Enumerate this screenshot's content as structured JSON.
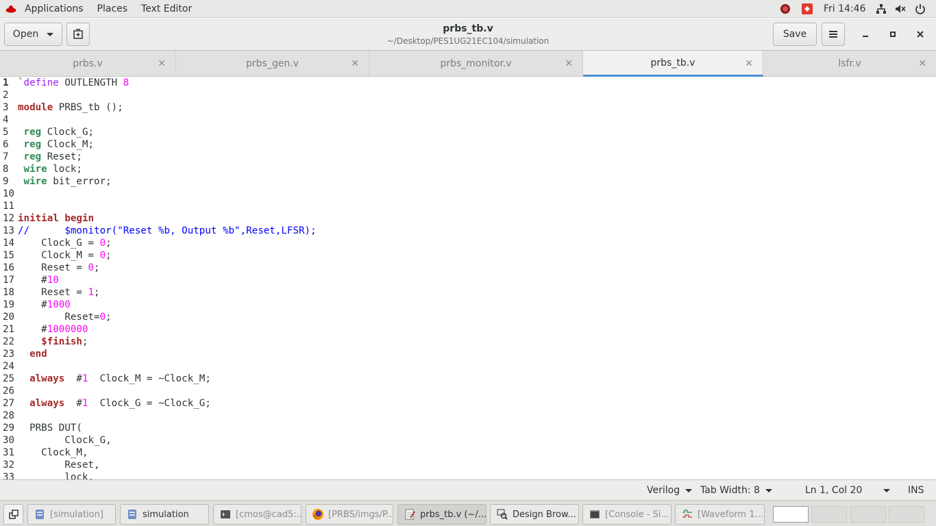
{
  "topbar": {
    "menus": [
      "Applications",
      "Places",
      "Text Editor"
    ],
    "clock": "Fri 14:46"
  },
  "header": {
    "open_label": "Open",
    "title": "prbs_tb.v",
    "subtitle": "~/Desktop/PES1UG21EC104/simulation",
    "save_label": "Save"
  },
  "tabs": [
    {
      "label": "prbs.v"
    },
    {
      "label": "prbs_gen.v"
    },
    {
      "label": "prbs_monitor.v"
    },
    {
      "label": "prbs_tb.v"
    },
    {
      "label": "lsfr.v"
    }
  ],
  "editor": {
    "active_tab": "prbs_tb.v",
    "lines": [
      [
        {
          "t": "`",
          "c": ""
        },
        {
          "t": "define",
          "c": "pp"
        },
        {
          "t": " OUTLENGTH ",
          "c": ""
        },
        {
          "t": "8",
          "c": "num"
        }
      ],
      [],
      [
        {
          "t": "module",
          "c": "kw-b"
        },
        {
          "t": " PRBS_tb ();",
          "c": ""
        }
      ],
      [],
      [
        {
          "t": " ",
          "c": ""
        },
        {
          "t": "reg",
          "c": "kw-g"
        },
        {
          "t": " Clock_G;",
          "c": ""
        }
      ],
      [
        {
          "t": " ",
          "c": ""
        },
        {
          "t": "reg",
          "c": "kw-g"
        },
        {
          "t": " Clock_M;",
          "c": ""
        }
      ],
      [
        {
          "t": " ",
          "c": ""
        },
        {
          "t": "reg",
          "c": "kw-g"
        },
        {
          "t": " Reset;",
          "c": ""
        }
      ],
      [
        {
          "t": " ",
          "c": ""
        },
        {
          "t": "wire",
          "c": "kw-g"
        },
        {
          "t": " lock;",
          "c": ""
        }
      ],
      [
        {
          "t": " ",
          "c": ""
        },
        {
          "t": "wire",
          "c": "kw-g"
        },
        {
          "t": " bit_error;",
          "c": ""
        }
      ],
      [],
      [],
      [
        {
          "t": "initial",
          "c": "kw-b"
        },
        {
          "t": " ",
          "c": ""
        },
        {
          "t": "begin",
          "c": "kw-b"
        }
      ],
      [
        {
          "t": "//      $monitor(\"Reset %b, Output %b\",Reset,LFSR);",
          "c": "cmt"
        }
      ],
      [
        {
          "t": "    Clock_G = ",
          "c": ""
        },
        {
          "t": "0",
          "c": "num"
        },
        {
          "t": ";",
          "c": ""
        }
      ],
      [
        {
          "t": "    Clock_M = ",
          "c": ""
        },
        {
          "t": "0",
          "c": "num"
        },
        {
          "t": ";",
          "c": ""
        }
      ],
      [
        {
          "t": "    Reset = ",
          "c": ""
        },
        {
          "t": "0",
          "c": "num"
        },
        {
          "t": ";",
          "c": ""
        }
      ],
      [
        {
          "t": "    #",
          "c": ""
        },
        {
          "t": "10",
          "c": "num"
        }
      ],
      [
        {
          "t": "    Reset = ",
          "c": ""
        },
        {
          "t": "1",
          "c": "num"
        },
        {
          "t": ";",
          "c": ""
        }
      ],
      [
        {
          "t": "    #",
          "c": ""
        },
        {
          "t": "1000",
          "c": "num"
        }
      ],
      [
        {
          "t": "        Reset=",
          "c": ""
        },
        {
          "t": "0",
          "c": "num"
        },
        {
          "t": ";",
          "c": ""
        }
      ],
      [
        {
          "t": "    #",
          "c": ""
        },
        {
          "t": "1000000",
          "c": "num"
        }
      ],
      [
        {
          "t": "    ",
          "c": ""
        },
        {
          "t": "$finish",
          "c": "kw-b"
        },
        {
          "t": ";",
          "c": ""
        }
      ],
      [
        {
          "t": "  ",
          "c": ""
        },
        {
          "t": "end",
          "c": "kw-b"
        }
      ],
      [],
      [
        {
          "t": "  ",
          "c": ""
        },
        {
          "t": "always",
          "c": "kw-b"
        },
        {
          "t": "  #",
          "c": ""
        },
        {
          "t": "1",
          "c": "num"
        },
        {
          "t": "  Clock_M = ~Clock_M;",
          "c": ""
        }
      ],
      [],
      [
        {
          "t": "  ",
          "c": ""
        },
        {
          "t": "always",
          "c": "kw-b"
        },
        {
          "t": "  #",
          "c": ""
        },
        {
          "t": "1",
          "c": "num"
        },
        {
          "t": "  Clock_G = ~Clock_G;",
          "c": ""
        }
      ],
      [],
      [
        {
          "t": "  PRBS DUT(",
          "c": ""
        }
      ],
      [
        {
          "t": "        Clock_G,",
          "c": ""
        }
      ],
      [
        {
          "t": "    Clock_M,",
          "c": ""
        }
      ],
      [
        {
          "t": "        Reset,",
          "c": ""
        }
      ],
      [
        {
          "t": "        lock,",
          "c": ""
        }
      ]
    ]
  },
  "statusbar": {
    "language": "Verilog",
    "tab_width": "Tab Width: 8",
    "position": "Ln 1, Col 20",
    "mode": "INS"
  },
  "taskbar": {
    "tasks": [
      {
        "label": "[simulation]",
        "icon": "file-manager-icon"
      },
      {
        "label": "simulation",
        "icon": "file-manager-icon"
      },
      {
        "label": "[cmos@cad5:...",
        "icon": "terminal-icon"
      },
      {
        "label": "[PRBS/imgs/P...",
        "icon": "firefox-icon"
      },
      {
        "label": "prbs_tb.v (~/...",
        "icon": "text-editor-icon"
      },
      {
        "label": "Design Brow...",
        "icon": "design-browser-icon"
      },
      {
        "label": "[Console - Si...",
        "icon": "console-icon"
      },
      {
        "label": "[Waveform 1...",
        "icon": "waveform-icon"
      }
    ]
  },
  "colors": {
    "keyword": "#a52a2a",
    "type_keyword": "#2e8b57",
    "number": "#ff00ff",
    "comment": "#0000ff",
    "preprocessor": "#a020f0",
    "active_tab_underline": "#4a90d9"
  }
}
